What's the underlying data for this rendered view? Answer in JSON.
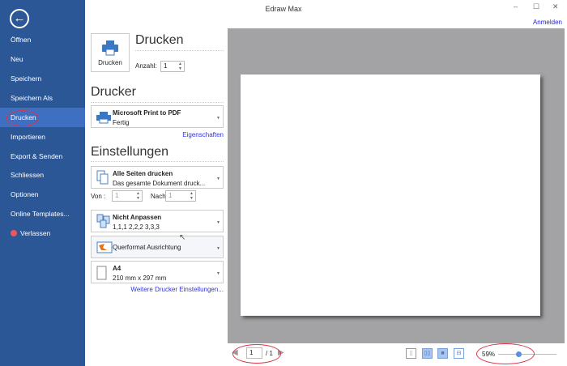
{
  "window": {
    "title": "Edraw Max",
    "minimize": "–",
    "maximize": "☐",
    "close": "✕",
    "login": "Anmelden"
  },
  "sidebar": {
    "back": "←",
    "items": [
      "Öffnen",
      "Neu",
      "Speichern",
      "Speichern Als",
      "Drucken",
      "Importieren",
      "Export & Senden",
      "Schliessen",
      "Optionen",
      "Online Templates...",
      "Verlassen"
    ]
  },
  "print": {
    "heading": "Drucken",
    "button": "Drucken",
    "copies_label": "Anzahl:",
    "copies": "1"
  },
  "printer": {
    "heading": "Drucker",
    "name": "Microsoft Print to PDF",
    "status": "Fertig",
    "properties": "Eigenschaften"
  },
  "settings": {
    "heading": "Einstellungen",
    "pages_title": "Alle Seiten drucken",
    "pages_sub": "Das gesamte Dokument druck...",
    "from_label": "Von :",
    "from": "1",
    "to_label": "Nach",
    "to": "1",
    "collate_title": "Nicht Anpassen",
    "collate_sub": "1,1,1   2,2,2   3,3,3",
    "orientation": "Querformat Ausrichtung",
    "paper_title": "A4",
    "paper_sub": "210 mm x 297 mm",
    "more": "Weitere Drucker Einstellungen..."
  },
  "footer": {
    "page": "1",
    "total": "/ 1",
    "zoom": "59%",
    "zoom_fraction": 0.35
  }
}
